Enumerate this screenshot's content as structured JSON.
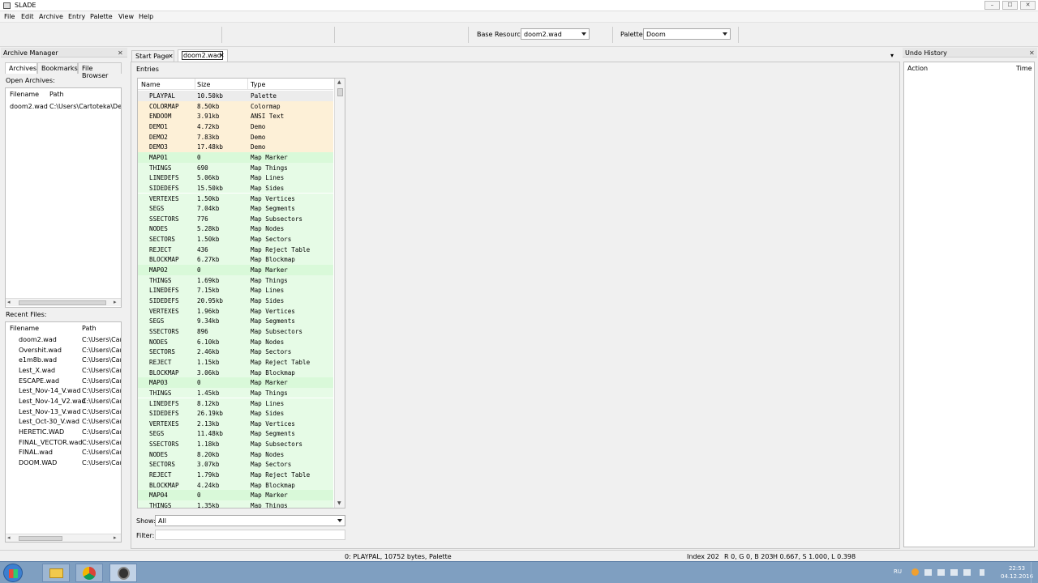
{
  "window": {
    "title": "SLADE",
    "min_glyph": "–",
    "max_glyph": "☐",
    "close_glyph": "✕"
  },
  "menu": [
    "File",
    "Edit",
    "Archive",
    "Entry",
    "Palette",
    "View",
    "Help"
  ],
  "toolbar": {
    "base_resource_label": "Base Resource:",
    "base_resource_value": "doom2.wad",
    "palette_label": "Palette:",
    "palette_value": "Doom"
  },
  "archive_manager": {
    "title": "Archive Manager",
    "close_glyph": "✕",
    "tabs": [
      "Archives",
      "Bookmarks",
      "File Browser"
    ],
    "open_archives_label": "Open Archives:",
    "open_columns": [
      "Filename",
      "Path"
    ],
    "open_archives": [
      {
        "filename": "doom2.wad",
        "path": "C:\\Users\\Cartoteka\\Desk"
      }
    ],
    "recent_label": "Recent Files:",
    "recent_columns": [
      "Filename",
      "Path"
    ],
    "recent_files": [
      {
        "filename": "doom2.wad",
        "path": "C:\\Users\\Cart"
      },
      {
        "filename": "Overshit.wad",
        "path": "C:\\Users\\Cart"
      },
      {
        "filename": "e1m8b.wad",
        "path": "C:\\Users\\Cart"
      },
      {
        "filename": "Lest_X.wad",
        "path": "C:\\Users\\Cart"
      },
      {
        "filename": "ESCAPE.wad",
        "path": "C:\\Users\\Cart"
      },
      {
        "filename": "Lest_Nov-14_V.wad",
        "path": "C:\\Users\\Cart"
      },
      {
        "filename": "Lest_Nov-14_V2.wad",
        "path": "C:\\Users\\Cart"
      },
      {
        "filename": "Lest_Nov-13_V.wad",
        "path": "C:\\Users\\Cart"
      },
      {
        "filename": "Lest_Oct-30_V.wad",
        "path": "C:\\Users\\Cart"
      },
      {
        "filename": "HERETIC.WAD",
        "path": "C:\\Users\\Cart"
      },
      {
        "filename": "FINAL_VECTOR.wad",
        "path": "C:\\Users\\Cart"
      },
      {
        "filename": "FINAL.wad",
        "path": "C:\\Users\\Cart"
      },
      {
        "filename": "DOOM.WAD",
        "path": "C:\\Users\\Cart"
      }
    ],
    "scroll_left_glyph": "◂",
    "scroll_right_glyph": "▸",
    "scroll_thumb_glyph": "|||"
  },
  "doc_tabs": [
    {
      "label": "Start Page",
      "close_glyph": "✕"
    },
    {
      "label": "doom2.wad",
      "close_glyph": "✕"
    }
  ],
  "tab_dropdown_glyph": "▾",
  "entries": {
    "label": "Entries",
    "columns": [
      "Name",
      "Size",
      "Type"
    ],
    "scroll_up_glyph": "▲",
    "scroll_down_glyph": "▼",
    "rows": [
      {
        "name": "PLAYPAL",
        "size": "10.50kb",
        "type": "Palette",
        "color": "#ececec"
      },
      {
        "name": "COLORMAP",
        "size": "8.50kb",
        "type": "Colormap",
        "color": "#fdf0d7"
      },
      {
        "name": "ENDOOM",
        "size": "3.91kb",
        "type": "ANSI Text",
        "color": "#fdf0d7"
      },
      {
        "name": "DEMO1",
        "size": "4.72kb",
        "type": "Demo",
        "color": "#fdf0d7"
      },
      {
        "name": "DEMO2",
        "size": "7.83kb",
        "type": "Demo",
        "color": "#fdf0d7"
      },
      {
        "name": "DEMO3",
        "size": "17.48kb",
        "type": "Demo",
        "color": "#fdf0d7"
      },
      {
        "name": "MAP01",
        "size": "0",
        "type": "Map Marker",
        "color": "#d9f9d9"
      },
      {
        "name": "THINGS",
        "size": "690",
        "type": "Map Things",
        "color": "#e6fbe6"
      },
      {
        "name": "LINEDEFS",
        "size": "5.06kb",
        "type": "Map Lines",
        "color": "#e6fbe6"
      },
      {
        "name": "SIDEDEFS",
        "size": "15.50kb",
        "type": "Map Sides",
        "color": "#e6fbe6"
      },
      {
        "name": "VERTEXES",
        "size": "1.50kb",
        "type": "Map Vertices",
        "color": "#e6fbe6"
      },
      {
        "name": "SEGS",
        "size": "7.04kb",
        "type": "Map Segments",
        "color": "#e6fbe6"
      },
      {
        "name": "SSECTORS",
        "size": "776",
        "type": "Map Subsectors",
        "color": "#e6fbe6"
      },
      {
        "name": "NODES",
        "size": "5.28kb",
        "type": "Map Nodes",
        "color": "#e6fbe6"
      },
      {
        "name": "SECTORS",
        "size": "1.50kb",
        "type": "Map Sectors",
        "color": "#e6fbe6"
      },
      {
        "name": "REJECT",
        "size": "436",
        "type": "Map Reject Table",
        "color": "#e6fbe6"
      },
      {
        "name": "BLOCKMAP",
        "size": "6.27kb",
        "type": "Map Blockmap",
        "color": "#e6fbe6"
      },
      {
        "name": "MAP02",
        "size": "0",
        "type": "Map Marker",
        "color": "#d9f9d9"
      },
      {
        "name": "THINGS",
        "size": "1.69kb",
        "type": "Map Things",
        "color": "#e6fbe6"
      },
      {
        "name": "LINEDEFS",
        "size": "7.15kb",
        "type": "Map Lines",
        "color": "#e6fbe6"
      },
      {
        "name": "SIDEDEFS",
        "size": "20.95kb",
        "type": "Map Sides",
        "color": "#e6fbe6"
      },
      {
        "name": "VERTEXES",
        "size": "1.96kb",
        "type": "Map Vertices",
        "color": "#e6fbe6"
      },
      {
        "name": "SEGS",
        "size": "9.34kb",
        "type": "Map Segments",
        "color": "#e6fbe6"
      },
      {
        "name": "SSECTORS",
        "size": "896",
        "type": "Map Subsectors",
        "color": "#e6fbe6"
      },
      {
        "name": "NODES",
        "size": "6.10kb",
        "type": "Map Nodes",
        "color": "#e6fbe6"
      },
      {
        "name": "SECTORS",
        "size": "2.46kb",
        "type": "Map Sectors",
        "color": "#e6fbe6"
      },
      {
        "name": "REJECT",
        "size": "1.15kb",
        "type": "Map Reject Table",
        "color": "#e6fbe6"
      },
      {
        "name": "BLOCKMAP",
        "size": "3.06kb",
        "type": "Map Blockmap",
        "color": "#e6fbe6"
      },
      {
        "name": "MAP03",
        "size": "0",
        "type": "Map Marker",
        "color": "#d9f9d9"
      },
      {
        "name": "THINGS",
        "size": "1.45kb",
        "type": "Map Things",
        "color": "#e6fbe6"
      },
      {
        "name": "LINEDEFS",
        "size": "8.12kb",
        "type": "Map Lines",
        "color": "#e6fbe6"
      },
      {
        "name": "SIDEDEFS",
        "size": "26.19kb",
        "type": "Map Sides",
        "color": "#e6fbe6"
      },
      {
        "name": "VERTEXES",
        "size": "2.13kb",
        "type": "Map Vertices",
        "color": "#e6fbe6"
      },
      {
        "name": "SEGS",
        "size": "11.48kb",
        "type": "Map Segments",
        "color": "#e6fbe6"
      },
      {
        "name": "SSECTORS",
        "size": "1.18kb",
        "type": "Map Subsectors",
        "color": "#e6fbe6"
      },
      {
        "name": "NODES",
        "size": "8.20kb",
        "type": "Map Nodes",
        "color": "#e6fbe6"
      },
      {
        "name": "SECTORS",
        "size": "3.07kb",
        "type": "Map Sectors",
        "color": "#e6fbe6"
      },
      {
        "name": "REJECT",
        "size": "1.79kb",
        "type": "Map Reject Table",
        "color": "#e6fbe6"
      },
      {
        "name": "BLOCKMAP",
        "size": "4.24kb",
        "type": "Map Blockmap",
        "color": "#e6fbe6"
      },
      {
        "name": "MAP04",
        "size": "0",
        "type": "Map Marker",
        "color": "#d9f9d9"
      },
      {
        "name": "THINGS",
        "size": "1.35kb",
        "type": "Map Things",
        "color": "#e6fbe6"
      }
    ],
    "show_label": "Show:",
    "show_value": "All",
    "filter_label": "Filter:",
    "filter_value": ""
  },
  "undo_history": {
    "title": "Undo History",
    "close_glyph": "✕",
    "columns": [
      "Action",
      "Time"
    ]
  },
  "status": {
    "entry": "0: PLAYPAL, 10752 bytes, Palette",
    "index": "Index 202",
    "rgb": "R 0, G 0, B 203",
    "hsl": "H 0.667, S 1.000, L 0.398"
  },
  "taskbar": {
    "lang": "RU",
    "time": "22:53",
    "date": "04.12.2016"
  }
}
